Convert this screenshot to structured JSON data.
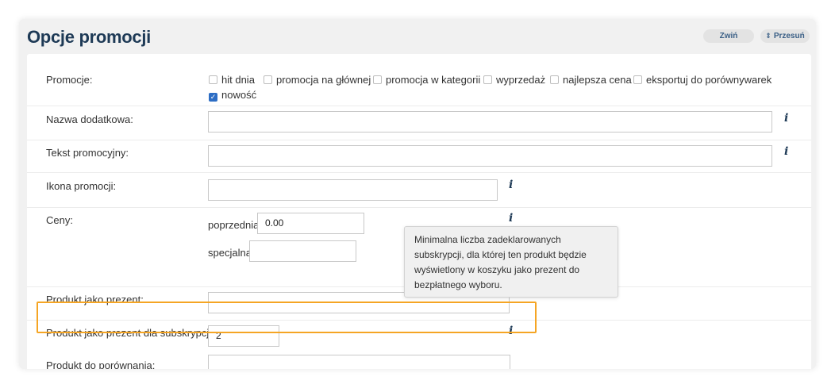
{
  "panel": {
    "title": "Opcje promocji",
    "collapse_label": "Zwiń",
    "move_label": "Przesuń",
    "move_arrow": "⇕"
  },
  "form": {
    "promotions": {
      "label": "Promocje:",
      "options": [
        {
          "label": "hit dnia",
          "checked": false
        },
        {
          "label": "promocja na głównej",
          "checked": false
        },
        {
          "label": "promocja w kategorii",
          "checked": false
        },
        {
          "label": "wyprzedaż",
          "checked": false
        },
        {
          "label": "najlepsza cena",
          "checked": false
        },
        {
          "label": "eksportuj do porównywarek",
          "checked": false
        },
        {
          "label": "nowość",
          "checked": true
        }
      ]
    },
    "extra_name": {
      "label": "Nazwa dodatkowa:",
      "value": ""
    },
    "promo_text": {
      "label": "Tekst promocyjny:",
      "value": ""
    },
    "promo_icon": {
      "label": "Ikona promocji:",
      "value": ""
    },
    "prices": {
      "label": "Ceny:",
      "previous_label": "poprzednia",
      "previous_value": "0.00",
      "special_label": "specjalna",
      "special_value": ""
    },
    "gift_product": {
      "label": "Produkt jako prezent:",
      "value": ""
    },
    "gift_subscription": {
      "label": "Produkt jako prezent dla subskrypcji:",
      "value": "2"
    },
    "compare_product": {
      "label": "Produkt do porównania:",
      "value": ""
    },
    "info_glyph": "i"
  },
  "tooltip": {
    "text": "Minimalna liczba zadeklarowanych subskrypcji, dla której ten produkt będzie wyświetlony w koszyku jako prezent do bezpłatnego wyboru."
  },
  "colors": {
    "title": "#1e3a56",
    "highlight": "#f5a524",
    "checkbox_checked": "#2d6dc4"
  }
}
